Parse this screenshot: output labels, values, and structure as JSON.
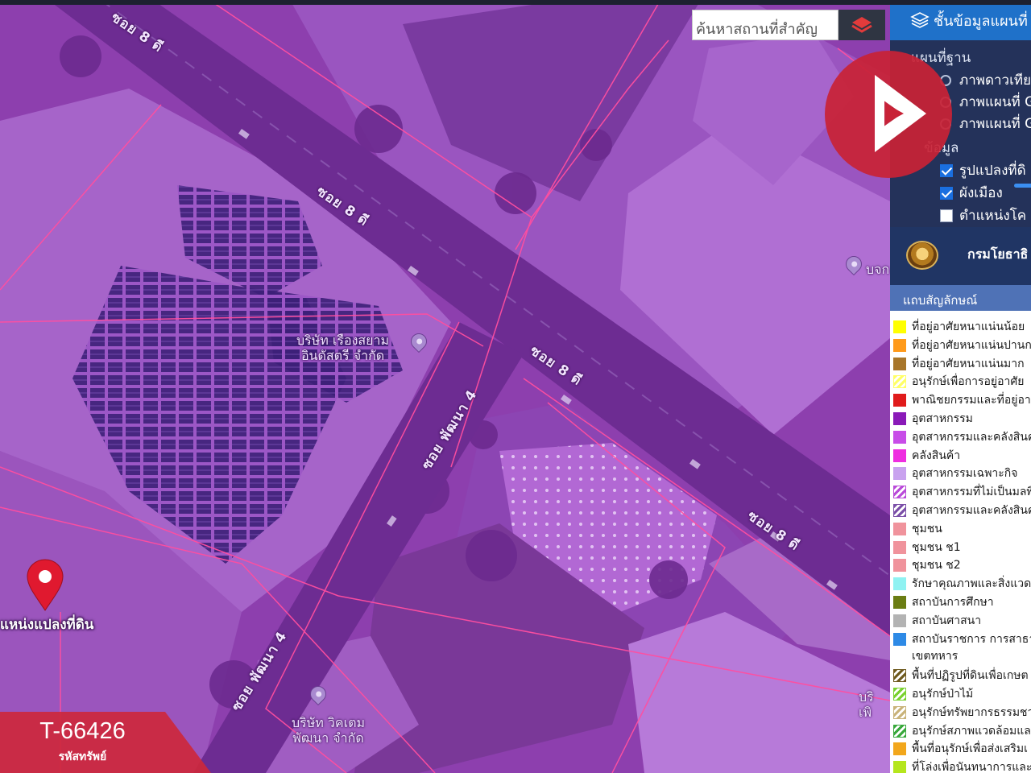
{
  "search": {
    "placeholder": "ค้นหาสถานที่สำคัญ"
  },
  "map": {
    "roads": [
      "ซอย 8 ดี",
      "ซอย 8 ดี",
      "ซอย 8 ดี",
      "ซอย 8 ดี",
      "ซอย พัฒนา 4",
      "ซอย พัฒนา 4"
    ],
    "places": [
      {
        "line1": "บริษัท เรืองสยาม",
        "line2": "อินดัสตรี จำกัด"
      },
      {
        "line1": "บริษัท วิคเตม",
        "line2": "พัฒนา จำกัด"
      },
      {
        "line1": "บจก",
        "line2": ""
      },
      {
        "line1": "บริ",
        "line2": "เพิ"
      }
    ],
    "marker_label": "แหน่งแปลงที่ดิน",
    "overlay_color": "#8a3bab"
  },
  "panel": {
    "title": "ชั้นข้อมูลแผนที่",
    "basemap_group": "แผนที่ฐาน",
    "basemaps": [
      "ภาพดาวเทีย",
      "ภาพแผนที่ G",
      "ภาพแผนที่ G"
    ],
    "data_group": "ข้อมูล",
    "layers": [
      {
        "label": "รูปแปลงที่ดิ",
        "checked": true
      },
      {
        "label": "ผังเมือง",
        "checked": true
      },
      {
        "label": "ตำแหน่งโค",
        "checked": false
      }
    ],
    "agency": "กรมโยธาธิ",
    "legend_title": "แถบสัญลักษณ์",
    "legend": [
      {
        "label": "ที่อยู่อาศัยหนาแน่นน้อย",
        "color": "#ffff00"
      },
      {
        "label": "ที่อยู่อาศัยหนาแน่นปานก",
        "color": "#ff9a1a"
      },
      {
        "label": "ที่อยู่อาศัยหนาแน่นมาก",
        "color": "#a8762a"
      },
      {
        "label": "อนุรักษ์เพื่อการอยู่อาศัย",
        "color": "#ffff66",
        "pattern": "hatch"
      },
      {
        "label": "พาณิชยกรรมและที่อยู่อาศั",
        "color": "#e01b1b"
      },
      {
        "label": "อุตสาหกรรม",
        "color": "#8a1ab8"
      },
      {
        "label": "อุตสาหกรรมและคลังสินค",
        "color": "#c84de8"
      },
      {
        "label": "คลังสินค้า",
        "color": "#ef2ee0"
      },
      {
        "label": "อุตสาหกรรมเฉพาะกิจ",
        "color": "#c9a2ef"
      },
      {
        "label": "อุตสาหกรรมที่ไม่เป็นมลพิ",
        "color": "#b94ad9",
        "pattern": "hatch"
      },
      {
        "label": "อุตสาหกรรมและคลังสินค",
        "color": "#7b4fa8",
        "pattern": "hatch"
      },
      {
        "label": "ชุมชน",
        "color": "#f0939c"
      },
      {
        "label": "ชุมชน ช1",
        "color": "#f0939c"
      },
      {
        "label": "ชุมชน ช2",
        "color": "#f0939c"
      },
      {
        "label": "รักษาคุณภาพและสิ่งแวดล",
        "color": "#8ff2f2"
      },
      {
        "label": "สถาบันการศึกษา",
        "color": "#6b7d13"
      },
      {
        "label": "สถาบันศาสนา",
        "color": "#b3b3b3"
      },
      {
        "label": "สถาบันราชการ การสาธา",
        "color": "#2e8ae6",
        "sub": "เขตทหาร"
      },
      {
        "label": "พื้นที่ปฏิรูปที่ดินเพื่อเกษต",
        "color": "#6e5a1e",
        "pattern": "hatch"
      },
      {
        "label": "อนุรักษ์ป่าไม้",
        "color": "#7ad12f",
        "pattern": "hatch"
      },
      {
        "label": "อนุรักษ์ทรัพยากรธรรมชา",
        "color": "#c9b37a",
        "pattern": "hatch"
      },
      {
        "label": "อนุรักษ์สภาพแวดล้อมแล",
        "color": "#38a83b",
        "pattern": "hatch"
      },
      {
        "label": "พื้นที่อนุรักษ์เพื่อส่งเสริมเ",
        "color": "#f2a71c"
      },
      {
        "label": "ที่โล่งเพื่อนันทนาการและ",
        "color": "#b5e61d"
      }
    ]
  },
  "asset": {
    "code": "T-66426",
    "caption": "รหัสทรัพย์"
  }
}
